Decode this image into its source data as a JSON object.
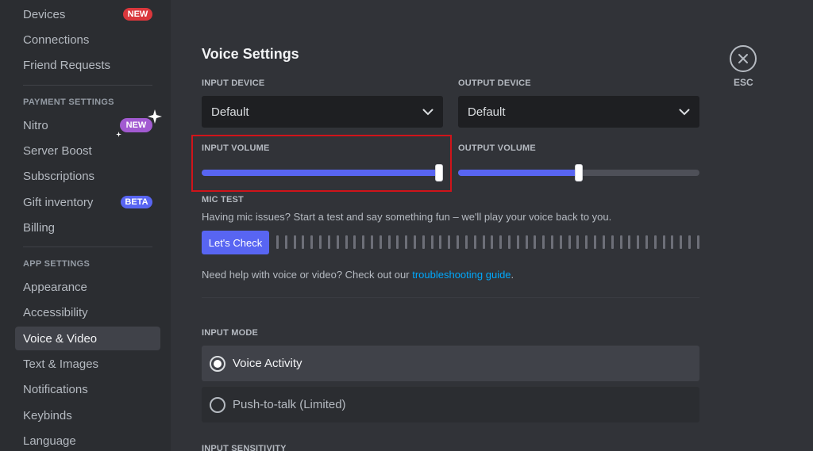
{
  "sidebar": {
    "user_items": [
      {
        "label": "Devices",
        "badge": "NEW"
      },
      {
        "label": "Connections"
      },
      {
        "label": "Friend Requests"
      }
    ],
    "payment_header": "PAYMENT SETTINGS",
    "payment_items": [
      {
        "label": "Nitro",
        "badge": "NEW"
      },
      {
        "label": "Server Boost"
      },
      {
        "label": "Subscriptions"
      },
      {
        "label": "Gift inventory",
        "badge": "BETA"
      },
      {
        "label": "Billing"
      }
    ],
    "app_header": "APP SETTINGS",
    "app_items": [
      {
        "label": "Appearance"
      },
      {
        "label": "Accessibility"
      },
      {
        "label": "Voice & Video",
        "active": true
      },
      {
        "label": "Text & Images"
      },
      {
        "label": "Notifications"
      },
      {
        "label": "Keybinds"
      },
      {
        "label": "Language"
      }
    ]
  },
  "main": {
    "title": "Voice Settings",
    "input_device": {
      "label": "INPUT DEVICE",
      "value": "Default"
    },
    "output_device": {
      "label": "OUTPUT DEVICE",
      "value": "Default"
    },
    "input_volume": {
      "label": "INPUT VOLUME",
      "percent": 100
    },
    "output_volume": {
      "label": "OUTPUT VOLUME",
      "percent": 50
    },
    "mic_test": {
      "label": "MIC TEST",
      "description": "Having mic issues? Start a test and say something fun – we'll play your voice back to you.",
      "button": "Let's Check"
    },
    "help": {
      "prefix": "Need help with voice or video? Check out our ",
      "link": "troubleshooting guide",
      "suffix": "."
    },
    "input_mode": {
      "label": "INPUT MODE",
      "options": [
        {
          "label": "Voice Activity",
          "selected": true
        },
        {
          "label": "Push-to-talk (Limited)",
          "selected": false
        }
      ]
    },
    "input_sensitivity_label": "INPUT SENSITIVITY"
  },
  "close": {
    "label": "ESC"
  },
  "colors": {
    "accent": "#5865f2",
    "highlight": "#d0141a",
    "link": "#00a8fc"
  }
}
